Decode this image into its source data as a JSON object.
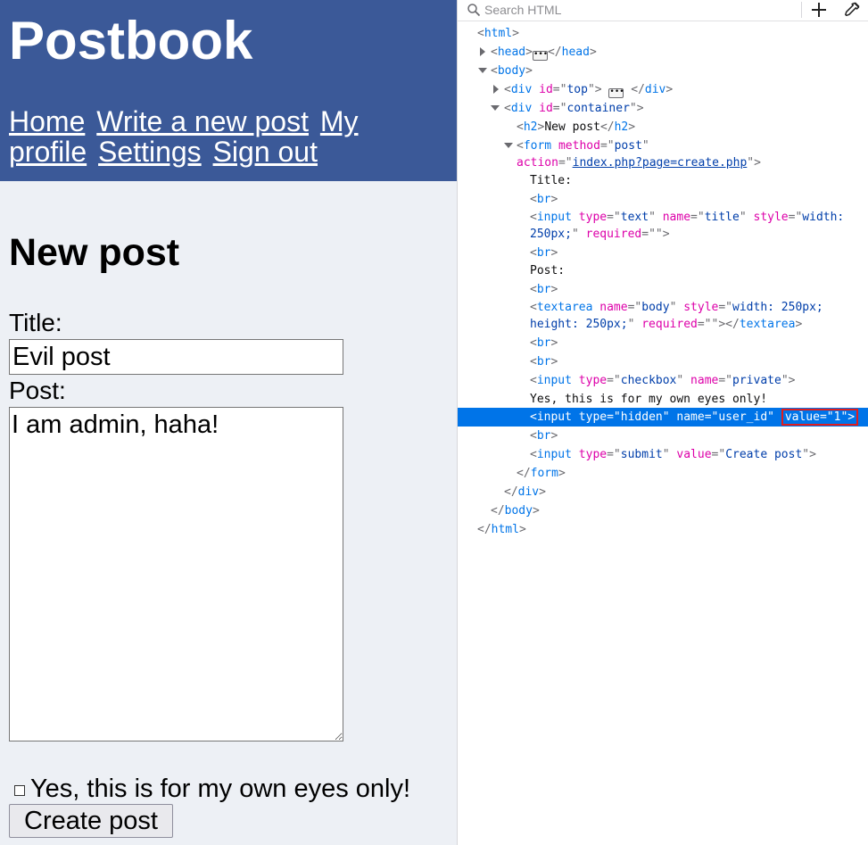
{
  "site": {
    "title": "Postbook",
    "nav": [
      "Home",
      "Write a new post",
      "My profile",
      "Settings",
      "Sign out"
    ]
  },
  "form": {
    "heading": "New post",
    "title_label": "Title:",
    "title_value": "Evil post",
    "post_label": "Post:",
    "body_value": "I am admin, haha!",
    "private_label": "Yes, this is for my own eyes only!",
    "private_checked": false,
    "submit_label": "Create post"
  },
  "devtools": {
    "search_placeholder": "Search HTML",
    "icons": {
      "search": "search-icon",
      "add": "add-node-icon",
      "picker": "eyedropper-icon"
    },
    "colors": {
      "selection": "#0074e8",
      "tag": "#0074e8",
      "attr_name": "#dd00a9",
      "attr_value": "#003eaa",
      "highlight_border": "#e11d1d"
    },
    "lines": {
      "html_open": "html",
      "head": "head",
      "body_open": "body",
      "div_top": {
        "tag": "div",
        "attr": "id",
        "val": "top"
      },
      "div_container": {
        "tag": "div",
        "attr": "id",
        "val": "container"
      },
      "h2": {
        "tag": "h2",
        "text": "New post"
      },
      "form_open": {
        "tag": "form",
        "a1": "method",
        "v1": "post",
        "a2": "action",
        "v2": "index.php?page=create.php"
      },
      "text_title": "Title:",
      "br": "br",
      "input_text": {
        "tag": "input",
        "a1": "type",
        "v1": "text",
        "a2": "name",
        "v2": "title",
        "a3": "style",
        "v3a": "width:",
        "v3b": "250px;",
        "a4": "required",
        "v4": ""
      },
      "text_post": "Post:",
      "textarea": {
        "tag": "textarea",
        "a1": "name",
        "v1": "body",
        "a2": "style",
        "v2a": "width: 250px;",
        "v2b": "height: 250px;",
        "a3": "required",
        "v3": ""
      },
      "input_checkbox": {
        "tag": "input",
        "a1": "type",
        "v1": "checkbox",
        "a2": "name",
        "v2": "private"
      },
      "text_private": "Yes, this is for my own eyes only!",
      "input_hidden": {
        "tag": "input",
        "a1": "type",
        "v1": "hidden",
        "a2": "name",
        "v2": "user_id",
        "a3": "value",
        "v3": "1"
      },
      "input_submit": {
        "tag": "input",
        "a1": "type",
        "v1": "submit",
        "a2": "value",
        "v2": "Create post"
      },
      "form_close": "form",
      "div_close": "div",
      "body_close": "body",
      "html_close": "html"
    }
  }
}
